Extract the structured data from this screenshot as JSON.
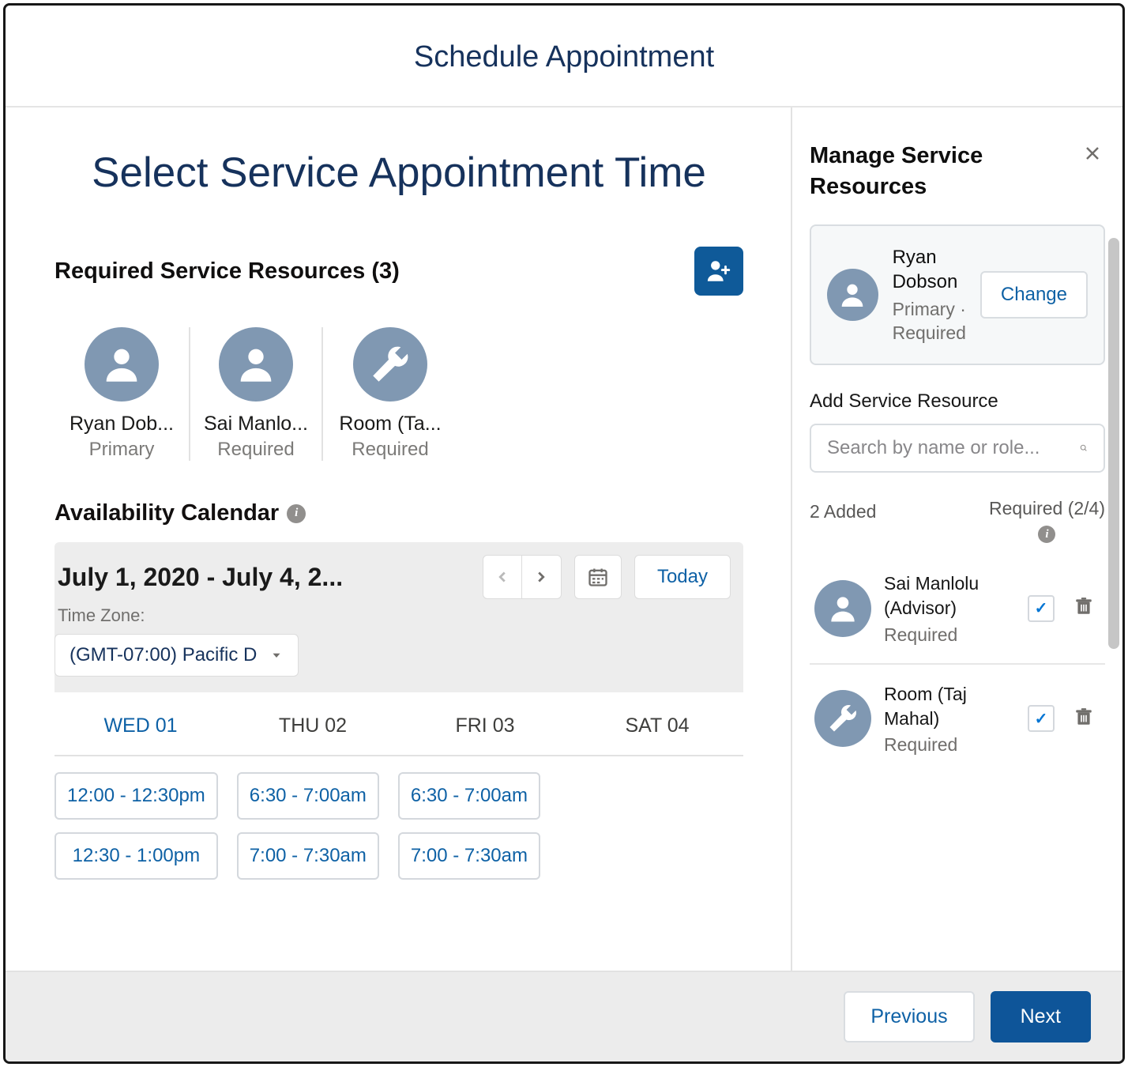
{
  "header": {
    "title": "Schedule Appointment"
  },
  "main": {
    "title": "Select Service Appointment Time",
    "resources_label": "Required Service Resources (3)",
    "resources": [
      {
        "name": "Ryan Dob...",
        "role": "Primary",
        "icon": "person"
      },
      {
        "name": "Sai Manlo...",
        "role": "Required",
        "icon": "person"
      },
      {
        "name": "Room (Ta...",
        "role": "Required",
        "icon": "wrench"
      }
    ],
    "calendar_label": "Availability Calendar",
    "date_range": "July 1, 2020 - July 4, 2...",
    "today_label": "Today",
    "tz_label": "Time Zone:",
    "tz_value": "(GMT-07:00) Pacific D",
    "days": [
      {
        "label": "WED 01",
        "active": true
      },
      {
        "label": "THU 02",
        "active": false
      },
      {
        "label": "FRI 03",
        "active": false
      },
      {
        "label": "SAT 04",
        "active": false
      }
    ],
    "slots": [
      [
        "12:00 - 12:30pm",
        "12:30 - 1:00pm"
      ],
      [
        "6:30 - 7:00am",
        "7:00 - 7:30am"
      ],
      [
        "6:30 - 7:00am",
        "7:00 - 7:30am"
      ]
    ]
  },
  "panel": {
    "title": "Manage Service Resources",
    "primary": {
      "name": "Ryan Dobson",
      "role": "Primary · Required",
      "change_label": "Change"
    },
    "add_label": "Add Service Resource",
    "search_placeholder": "Search by name or role...",
    "added_count": "2 Added",
    "required_count": "Required (2/4)",
    "items": [
      {
        "name": "Sai Manlolu (Advisor)",
        "role": "Required",
        "icon": "person"
      },
      {
        "name": "Room (Taj Mahal)",
        "role": "Required",
        "icon": "wrench"
      }
    ]
  },
  "footer": {
    "previous": "Previous",
    "next": "Next"
  }
}
